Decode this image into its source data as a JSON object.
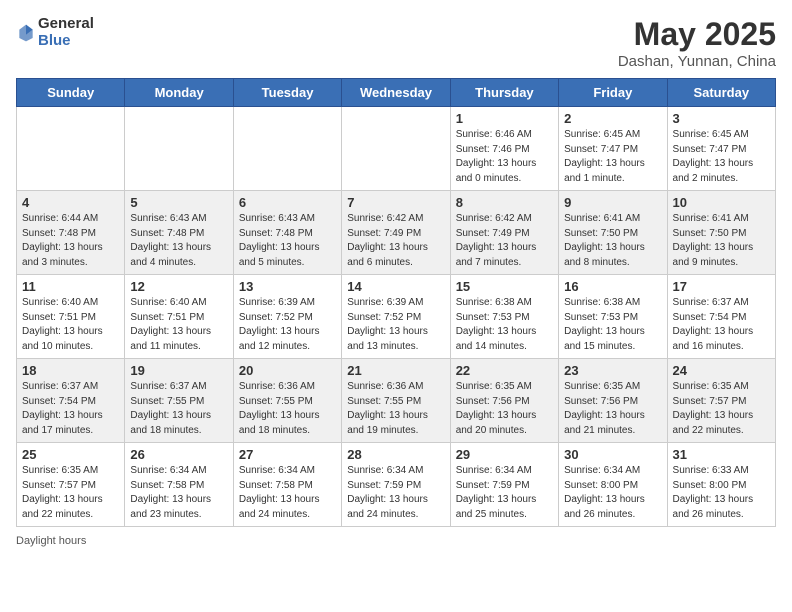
{
  "header": {
    "logo_general": "General",
    "logo_blue": "Blue",
    "month_year": "May 2025",
    "location": "Dashan, Yunnan, China"
  },
  "days_of_week": [
    "Sunday",
    "Monday",
    "Tuesday",
    "Wednesday",
    "Thursday",
    "Friday",
    "Saturday"
  ],
  "weeks": [
    [
      {
        "day": "",
        "info": ""
      },
      {
        "day": "",
        "info": ""
      },
      {
        "day": "",
        "info": ""
      },
      {
        "day": "",
        "info": ""
      },
      {
        "day": "1",
        "info": "Sunrise: 6:46 AM\nSunset: 7:46 PM\nDaylight: 13 hours and 0 minutes."
      },
      {
        "day": "2",
        "info": "Sunrise: 6:45 AM\nSunset: 7:47 PM\nDaylight: 13 hours and 1 minute."
      },
      {
        "day": "3",
        "info": "Sunrise: 6:45 AM\nSunset: 7:47 PM\nDaylight: 13 hours and 2 minutes."
      }
    ],
    [
      {
        "day": "4",
        "info": "Sunrise: 6:44 AM\nSunset: 7:48 PM\nDaylight: 13 hours and 3 minutes."
      },
      {
        "day": "5",
        "info": "Sunrise: 6:43 AM\nSunset: 7:48 PM\nDaylight: 13 hours and 4 minutes."
      },
      {
        "day": "6",
        "info": "Sunrise: 6:43 AM\nSunset: 7:48 PM\nDaylight: 13 hours and 5 minutes."
      },
      {
        "day": "7",
        "info": "Sunrise: 6:42 AM\nSunset: 7:49 PM\nDaylight: 13 hours and 6 minutes."
      },
      {
        "day": "8",
        "info": "Sunrise: 6:42 AM\nSunset: 7:49 PM\nDaylight: 13 hours and 7 minutes."
      },
      {
        "day": "9",
        "info": "Sunrise: 6:41 AM\nSunset: 7:50 PM\nDaylight: 13 hours and 8 minutes."
      },
      {
        "day": "10",
        "info": "Sunrise: 6:41 AM\nSunset: 7:50 PM\nDaylight: 13 hours and 9 minutes."
      }
    ],
    [
      {
        "day": "11",
        "info": "Sunrise: 6:40 AM\nSunset: 7:51 PM\nDaylight: 13 hours and 10 minutes."
      },
      {
        "day": "12",
        "info": "Sunrise: 6:40 AM\nSunset: 7:51 PM\nDaylight: 13 hours and 11 minutes."
      },
      {
        "day": "13",
        "info": "Sunrise: 6:39 AM\nSunset: 7:52 PM\nDaylight: 13 hours and 12 minutes."
      },
      {
        "day": "14",
        "info": "Sunrise: 6:39 AM\nSunset: 7:52 PM\nDaylight: 13 hours and 13 minutes."
      },
      {
        "day": "15",
        "info": "Sunrise: 6:38 AM\nSunset: 7:53 PM\nDaylight: 13 hours and 14 minutes."
      },
      {
        "day": "16",
        "info": "Sunrise: 6:38 AM\nSunset: 7:53 PM\nDaylight: 13 hours and 15 minutes."
      },
      {
        "day": "17",
        "info": "Sunrise: 6:37 AM\nSunset: 7:54 PM\nDaylight: 13 hours and 16 minutes."
      }
    ],
    [
      {
        "day": "18",
        "info": "Sunrise: 6:37 AM\nSunset: 7:54 PM\nDaylight: 13 hours and 17 minutes."
      },
      {
        "day": "19",
        "info": "Sunrise: 6:37 AM\nSunset: 7:55 PM\nDaylight: 13 hours and 18 minutes."
      },
      {
        "day": "20",
        "info": "Sunrise: 6:36 AM\nSunset: 7:55 PM\nDaylight: 13 hours and 18 minutes."
      },
      {
        "day": "21",
        "info": "Sunrise: 6:36 AM\nSunset: 7:55 PM\nDaylight: 13 hours and 19 minutes."
      },
      {
        "day": "22",
        "info": "Sunrise: 6:35 AM\nSunset: 7:56 PM\nDaylight: 13 hours and 20 minutes."
      },
      {
        "day": "23",
        "info": "Sunrise: 6:35 AM\nSunset: 7:56 PM\nDaylight: 13 hours and 21 minutes."
      },
      {
        "day": "24",
        "info": "Sunrise: 6:35 AM\nSunset: 7:57 PM\nDaylight: 13 hours and 22 minutes."
      }
    ],
    [
      {
        "day": "25",
        "info": "Sunrise: 6:35 AM\nSunset: 7:57 PM\nDaylight: 13 hours and 22 minutes."
      },
      {
        "day": "26",
        "info": "Sunrise: 6:34 AM\nSunset: 7:58 PM\nDaylight: 13 hours and 23 minutes."
      },
      {
        "day": "27",
        "info": "Sunrise: 6:34 AM\nSunset: 7:58 PM\nDaylight: 13 hours and 24 minutes."
      },
      {
        "day": "28",
        "info": "Sunrise: 6:34 AM\nSunset: 7:59 PM\nDaylight: 13 hours and 24 minutes."
      },
      {
        "day": "29",
        "info": "Sunrise: 6:34 AM\nSunset: 7:59 PM\nDaylight: 13 hours and 25 minutes."
      },
      {
        "day": "30",
        "info": "Sunrise: 6:34 AM\nSunset: 8:00 PM\nDaylight: 13 hours and 26 minutes."
      },
      {
        "day": "31",
        "info": "Sunrise: 6:33 AM\nSunset: 8:00 PM\nDaylight: 13 hours and 26 minutes."
      }
    ]
  ],
  "footer": {
    "daylight_label": "Daylight hours"
  }
}
